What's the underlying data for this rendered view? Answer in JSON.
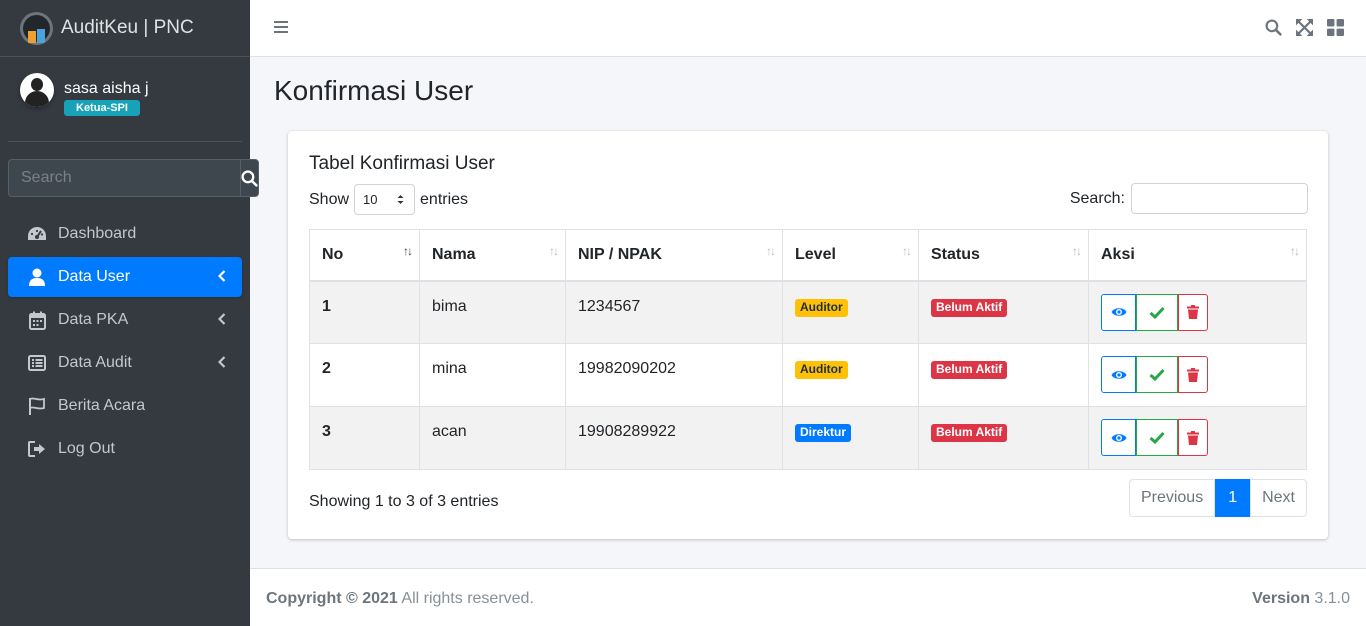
{
  "brand": {
    "name": "AuditKeu | PNC"
  },
  "user": {
    "name": "sasa aisha j",
    "role": "Ketua-SPI"
  },
  "sidebar": {
    "search_placeholder": "Search",
    "items": [
      {
        "label": "Dashboard",
        "icon": "tachometer-icon"
      },
      {
        "label": "Data User",
        "icon": "user-icon",
        "active": true
      },
      {
        "label": "Data PKA",
        "icon": "calendar-icon"
      },
      {
        "label": "Data Audit",
        "icon": "list-icon"
      },
      {
        "label": "Berita Acara",
        "icon": "flag-icon"
      },
      {
        "label": "Log Out",
        "icon": "sign-out-icon"
      }
    ]
  },
  "page": {
    "title": "Konfirmasi User"
  },
  "card": {
    "title": "Tabel Konfirmasi User",
    "show_label": "Show",
    "entries_value": "10",
    "entries_label": "entries",
    "search_label": "Search:"
  },
  "table": {
    "headers": [
      "No",
      "Nama",
      "NIP / NPAK",
      "Level",
      "Status",
      "Aksi"
    ],
    "rows": [
      {
        "no": "1",
        "nama": "bima",
        "nip": "1234567",
        "level": "Auditor",
        "status": "Belum Aktif"
      },
      {
        "no": "2",
        "nama": "mina",
        "nip": "19982090202",
        "level": "Auditor",
        "status": "Belum Aktif"
      },
      {
        "no": "3",
        "nama": "acan",
        "nip": "19908289922",
        "level": "Direktur",
        "status": "Belum Aktif"
      }
    ]
  },
  "pagination": {
    "info": "Showing 1 to 3 of 3 entries",
    "previous": "Previous",
    "current": "1",
    "next": "Next"
  },
  "footer": {
    "copyright_bold": "Copyright © 2021",
    "copyright_rest": " All rights reserved.",
    "version_label": "Version",
    "version_value": " 3.1.0"
  },
  "colors": {
    "sidebar": "#343a40",
    "primary": "#007bff",
    "warning": "#ffc107",
    "danger": "#dc3545",
    "success": "#28a745",
    "info": "#17a2b8"
  }
}
